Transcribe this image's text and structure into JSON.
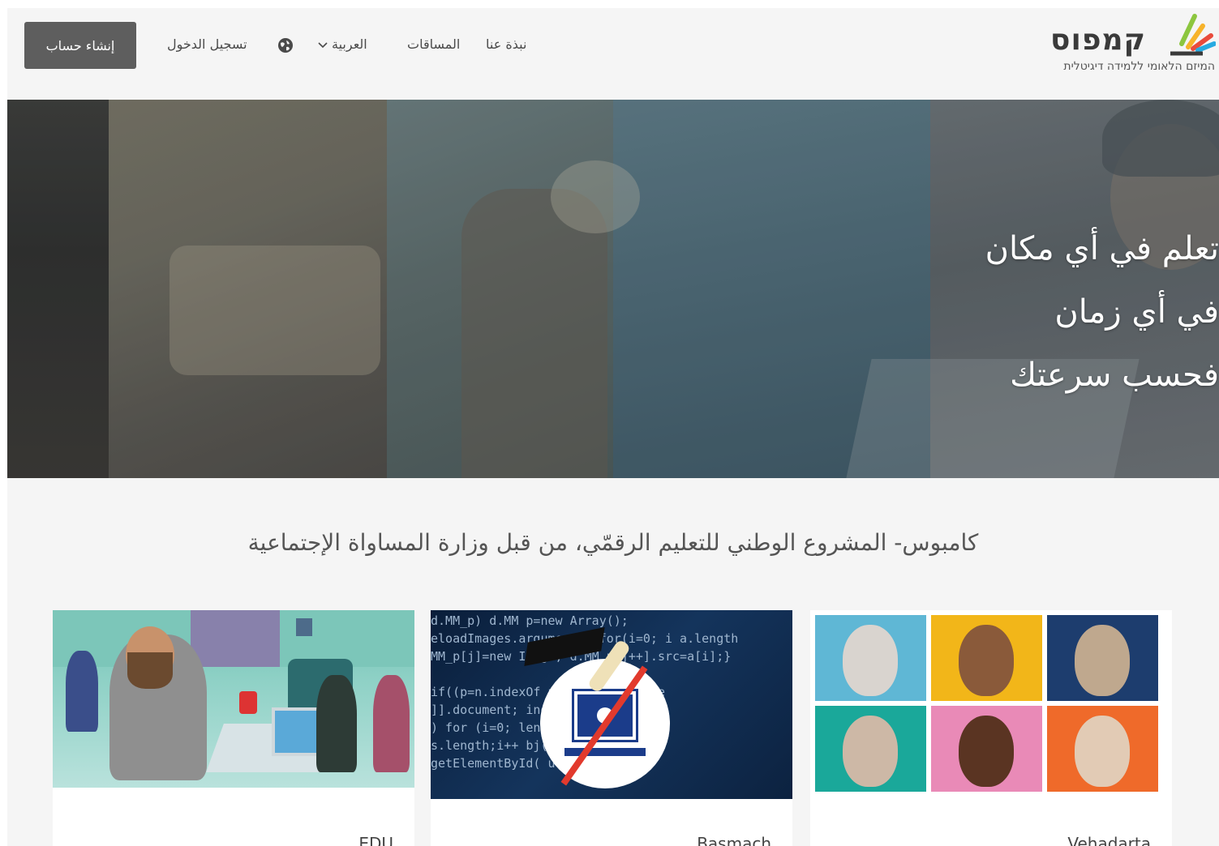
{
  "header": {
    "signup_label": "إنشاء حساب",
    "login_label": "تسجيل الدخول",
    "language_label": "العربية",
    "courses_label": "المساقات",
    "about_label": "نبذة عنا",
    "logo_text": "קמפוס",
    "logo_tagline": "המיזם הלאומי ללמידה דיגיטלית"
  },
  "hero": {
    "lines": [
      "تعلم في أي مكان",
      "في أي زمان",
      "فحسب سرعتك"
    ]
  },
  "intro": {
    "text": "كامبوس- المشروع الوطني للتعليم الرقمّي، من قبل وزارة المساواة الإجتماعية"
  },
  "cards": [
    {
      "title": "EDU"
    },
    {
      "title": "Basmach"
    },
    {
      "title": "Vehadarta"
    }
  ],
  "colors": {
    "signup_bg": "#5e5e5e",
    "page_bg": "#f5f5f5",
    "text": "#4a4a4a"
  },
  "icons": {
    "globe": "globe-icon",
    "language_chevron": "chevron-down-icon"
  }
}
